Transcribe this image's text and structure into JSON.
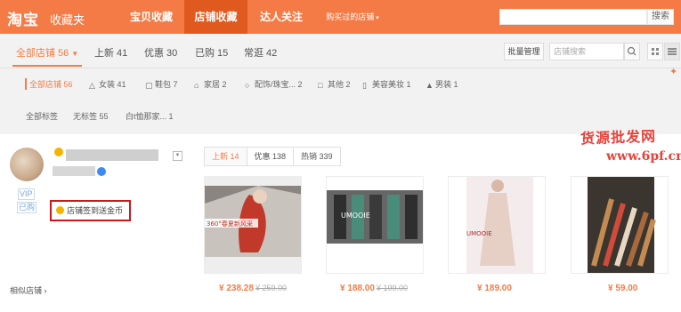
{
  "header": {
    "logo": "淘宝",
    "logo_sub": "收藏夹",
    "nav": [
      "宝贝收藏",
      "店铺收藏",
      "达人关注"
    ],
    "nav_dropdown": "购买过的店铺",
    "search_button": "搜索"
  },
  "tabs": {
    "items": [
      {
        "label": "全部店铺 56"
      },
      {
        "label": "上新 41"
      },
      {
        "label": "优惠 30"
      },
      {
        "label": "已购 15"
      },
      {
        "label": "常逛 42"
      }
    ],
    "batch_manage": "批量管理",
    "store_search_placeholder": "店铺搜索"
  },
  "categories": [
    {
      "label": "全部店铺 56",
      "icon": "store-icon"
    },
    {
      "label": "女装 41",
      "icon": "dress-icon"
    },
    {
      "label": "鞋包 7",
      "icon": "bag-icon"
    },
    {
      "label": "家居 2",
      "icon": "home-icon"
    },
    {
      "label": "配饰/珠宝... 2",
      "icon": "accessory-icon"
    },
    {
      "label": "其他 2",
      "icon": "other-icon"
    },
    {
      "label": "美容美妆 1",
      "icon": "makeup-icon"
    },
    {
      "label": "男装 1",
      "icon": "shirt-icon"
    }
  ],
  "tags": [
    "全部标签",
    "无标签 55",
    "白t恤那家... 1"
  ],
  "store": {
    "vip": "VIP",
    "purchased": "已购",
    "signin": "店铺签到送金币",
    "similar": "相似店铺",
    "product_tabs": [
      "上新 14",
      "优惠 138",
      "热销 339"
    ],
    "products": [
      {
        "price": "¥ 238.28",
        "old_price": "¥ 259.00",
        "img_text": "360°春夏新风采"
      },
      {
        "price": "¥ 188.00",
        "old_price": "¥ 199.00",
        "img_text": "UMOOIE"
      },
      {
        "price": "¥ 189.00",
        "old_price": "",
        "img_text": "UMOOIE"
      },
      {
        "price": "¥ 59.00",
        "old_price": "",
        "img_text": ""
      }
    ]
  },
  "watermark": {
    "line1": "货源批发网",
    "line2": "www.6pf.cn"
  }
}
